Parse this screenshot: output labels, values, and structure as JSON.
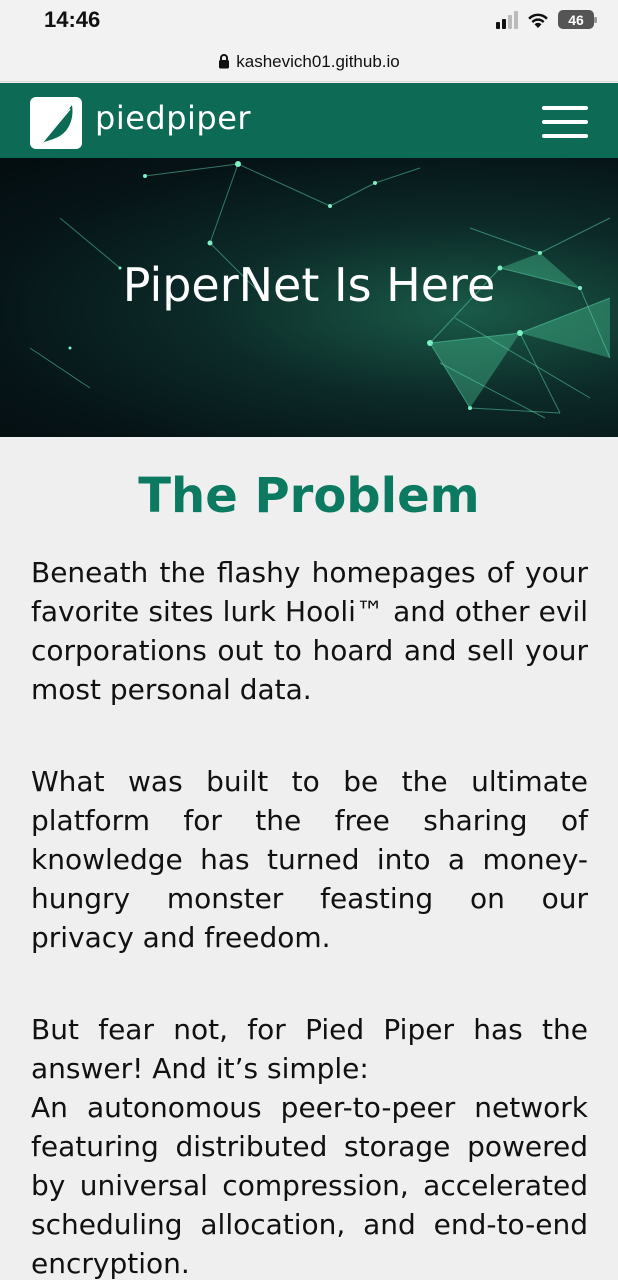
{
  "status_bar": {
    "time": "14:46",
    "battery": "46"
  },
  "browser": {
    "url": "kashevich01.github.io"
  },
  "nav": {
    "brand": "piedpiper"
  },
  "hero": {
    "title": "PiperNet Is Here"
  },
  "content": {
    "heading": "The Problem",
    "paragraph_1": "Beneath the flashy homepages of your favorite sites lurk Hooli™ and other evil corporations out to hoard and sell your most personal data.",
    "paragraph_2": "What was built to be the ultimate platform for the free sharing of knowledge has turned into a money-hungry monster feasting on our privacy and freedom.",
    "paragraph_3a": "But fear not, for Pied Piper has the answer! And it’s simple:",
    "paragraph_3b": "An autonomous peer-to-peer network featuring distributed storage powered by universal compression, accelerated scheduling allocation, and end-to-end encryption."
  },
  "colors": {
    "brand_green": "#0c6a55",
    "heading_green": "#0c7a60"
  }
}
